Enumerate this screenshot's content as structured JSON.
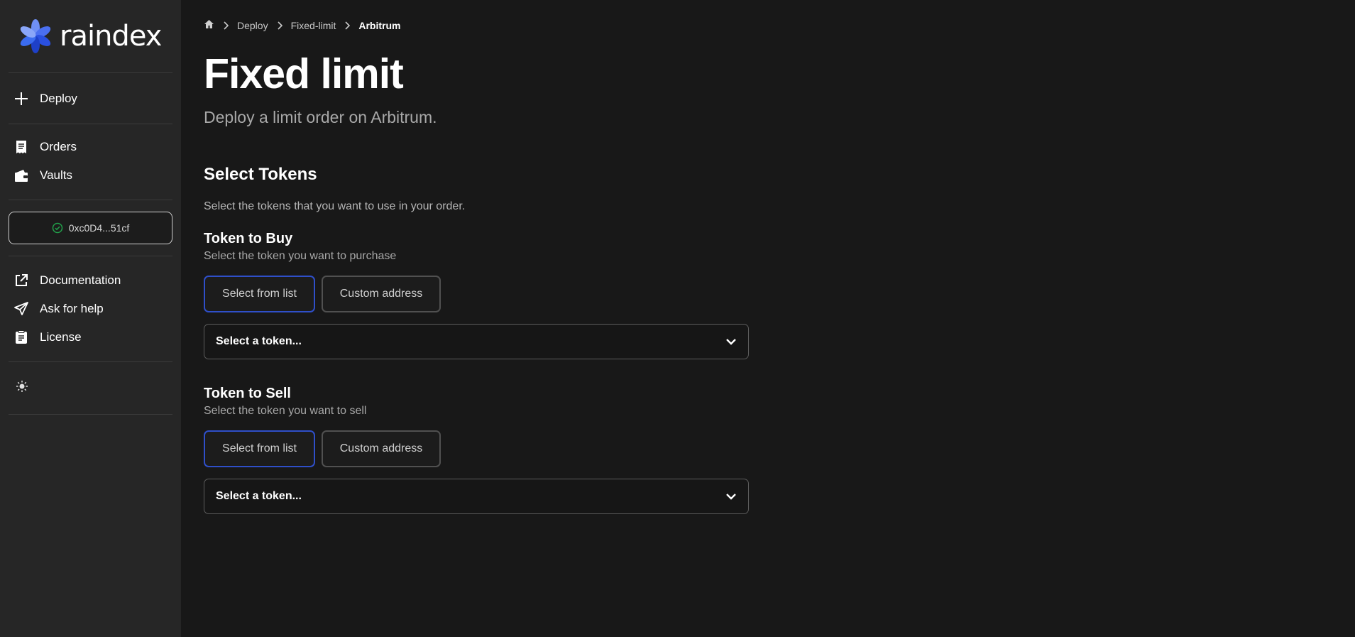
{
  "app": {
    "name": "raindex"
  },
  "sidebar": {
    "deploy_label": "Deploy",
    "nav": [
      {
        "label": "Orders",
        "icon": "receipt-icon"
      },
      {
        "label": "Vaults",
        "icon": "wallet-icon"
      }
    ],
    "wallet_address": "0xc0D4...51cf",
    "links": [
      {
        "label": "Documentation",
        "icon": "external-link-icon"
      },
      {
        "label": "Ask for help",
        "icon": "paper-plane-icon"
      },
      {
        "label": "License",
        "icon": "document-icon"
      }
    ],
    "theme_icon": "sun-icon"
  },
  "breadcrumb": {
    "items": [
      "Deploy",
      "Fixed-limit",
      "Arbitrum"
    ]
  },
  "page": {
    "title": "Fixed limit",
    "subtitle": "Deploy a limit order on Arbitrum."
  },
  "select_tokens": {
    "title": "Select Tokens",
    "description": "Select the tokens that you want to use in your order."
  },
  "token_buy": {
    "title": "Token to Buy",
    "description": "Select the token you want to purchase",
    "btn_list": "Select from list",
    "btn_custom": "Custom address",
    "select_placeholder": "Select a token..."
  },
  "token_sell": {
    "title": "Token to Sell",
    "description": "Select the token you want to sell",
    "btn_list": "Select from list",
    "btn_custom": "Custom address",
    "select_placeholder": "Select a token..."
  },
  "colors": {
    "background": "#181818",
    "sidebar": "#262626",
    "accent_blue": "#2f4fc9",
    "logo_blue": "#3b6cf0",
    "success_green": "#22a04a"
  }
}
